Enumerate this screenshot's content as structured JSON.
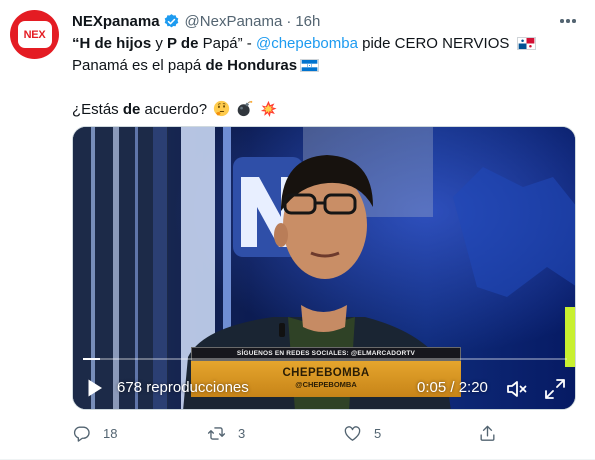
{
  "tweet": {
    "author_name": "NEXpanama",
    "handle": "@NexPanama",
    "separator": "·",
    "time": "16h",
    "avatar_text": "NEX",
    "text": {
      "q1": "“H de hijos",
      "y": " y ",
      "p": "P de",
      "papa": " Papá” - ",
      "mention": "@chepebomba",
      "pide": " pide CERO NERVIOS ",
      "panama": " Panamá es el papá ",
      "de_honduras": "de Honduras",
      "question_a": "¿Estás ",
      "question_de": "de",
      "question_b": " acuerdo?"
    }
  },
  "video": {
    "banner_top": "SÍGUENOS EN REDES SOCIALES: @ELMARCADORTV",
    "banner_name": "CHEPEBOMBA",
    "banner_handle": "@CHEPEBOMBA",
    "views": "678 reproducciones",
    "duration": "0:05 / 2:20",
    "progress_fraction": 0.036
  },
  "actions": {
    "reply_count": "18",
    "retweet_count": "3",
    "like_count": "5"
  },
  "colors": {
    "accent": "#1d9bf0",
    "brand_red": "#e41c23",
    "secondary_text": "#536471"
  },
  "icons": [
    "verified-icon",
    "more-icon",
    "panama-flag-icon",
    "honduras-flag-icon",
    "thinking-emoji-icon",
    "bomb-emoji-icon",
    "collision-emoji-icon",
    "play-icon",
    "mute-icon",
    "fullscreen-icon",
    "reply-icon",
    "retweet-icon",
    "like-icon",
    "share-icon"
  ]
}
